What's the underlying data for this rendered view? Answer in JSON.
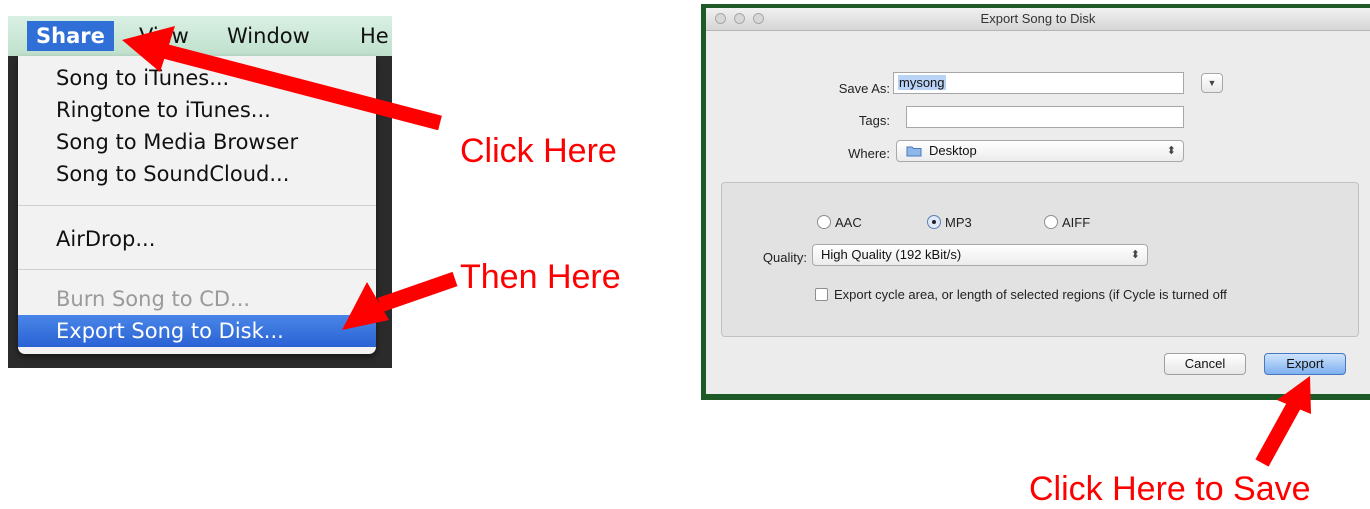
{
  "menu": {
    "menubar": [
      "Share",
      "View",
      "Window",
      "He"
    ],
    "items": {
      "song_to_itunes": "Song to iTunes...",
      "ringtone_to_itunes": "Ringtone to iTunes...",
      "song_to_media_browser": "Song to Media Browser",
      "song_to_soundcloud": "Song to SoundCloud...",
      "airdrop": "AirDrop...",
      "burn_song_to_cd": "Burn Song to CD...",
      "export_song_to_disk": "Export Song to Disk..."
    }
  },
  "annotations": {
    "click_here": "Click Here",
    "then_here": "Then Here",
    "click_here_to_save": "Click Here to Save",
    "color": "#ff0000"
  },
  "dialog": {
    "title": "Export Song to Disk",
    "save_as_label": "Save As:",
    "save_as_value": "mysong",
    "tags_label": "Tags:",
    "tags_value": "",
    "where_label": "Where:",
    "where_value": "Desktop",
    "formats": [
      "AAC",
      "MP3",
      "AIFF"
    ],
    "selected_format": "MP3",
    "quality_label": "Quality:",
    "quality_value": "High Quality (192 kBit/s)",
    "export_cycle_label": "Export cycle area, or length of selected regions (if Cycle is turned off",
    "export_cycle_checked": false,
    "cancel_label": "Cancel",
    "export_label": "Export"
  }
}
